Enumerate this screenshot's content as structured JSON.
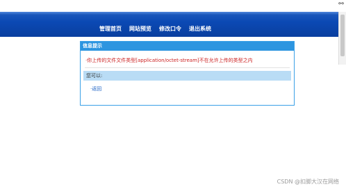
{
  "topbar": {
    "corner_icon": "glasses-icon"
  },
  "nav": {
    "items": [
      {
        "label": "管理首页"
      },
      {
        "label": "网站预览"
      },
      {
        "label": "修改口令"
      },
      {
        "label": "退出系统"
      }
    ]
  },
  "panel": {
    "title": "信息提示",
    "error": "·你上传的文件文件类型[application/octet-stream]不在允许上传的类型之内",
    "subhead": "您可以:",
    "back_link": "·返回"
  },
  "watermark": "CSDN @扣脚大汉在网络",
  "colors": {
    "header": "#0b49b4",
    "panel_title": "#2d95e0",
    "panel_border": "#3aa0e6",
    "error_text": "#cc2222",
    "link": "#1c62c4",
    "subhead_bg": "#b9dcf5"
  }
}
